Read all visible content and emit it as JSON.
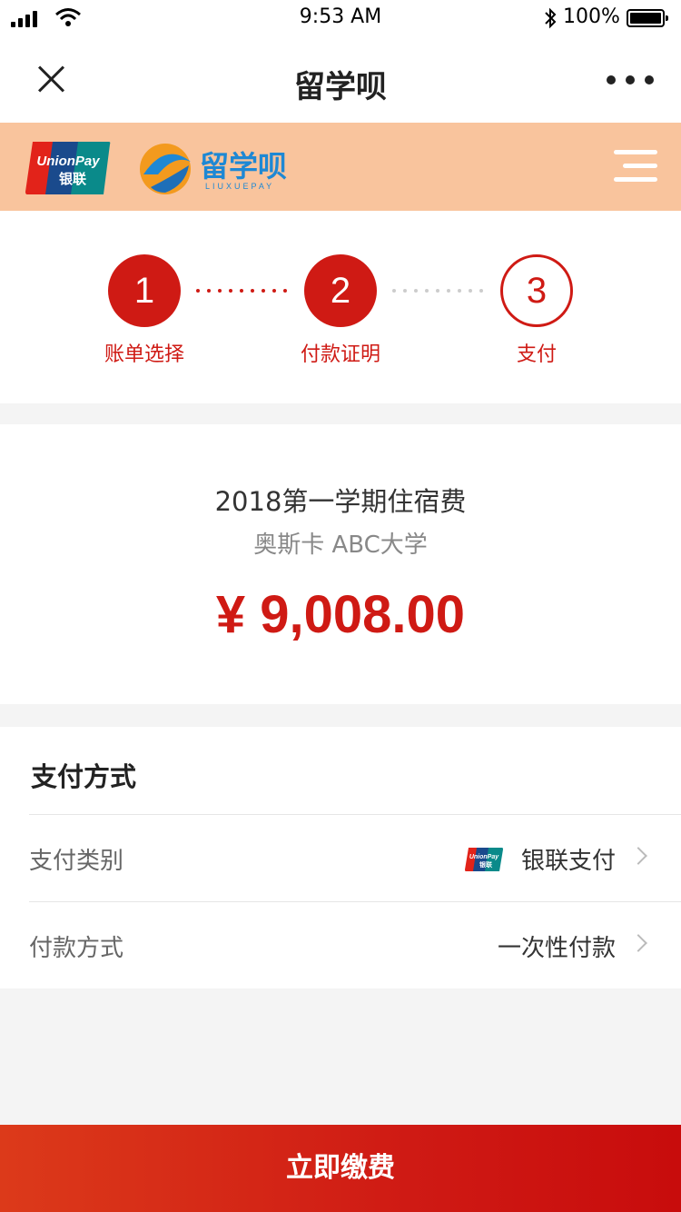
{
  "status_bar": {
    "time": "9:53 AM",
    "battery": "100%",
    "icons": [
      "signal-icon",
      "wifi-icon",
      "bluetooth-icon",
      "battery-icon"
    ]
  },
  "nav": {
    "title": "留学呗",
    "left_icon": "close-icon",
    "right_icon": "more-icon"
  },
  "banner": {
    "unionpay_text_top": "UnionPay",
    "unionpay_text_bottom": "银联",
    "brand_name": "留学呗",
    "brand_sub": "LIUXUEPAY",
    "menu_icon": "menu-icon"
  },
  "steps": [
    {
      "number": "1",
      "label": "账单选择",
      "state": "done"
    },
    {
      "number": "2",
      "label": "付款证明",
      "state": "done"
    },
    {
      "number": "3",
      "label": "支付",
      "state": "current"
    }
  ],
  "bill": {
    "title": "2018第一学期住宿费",
    "school": "奥斯卡 ABC大学",
    "amount": "¥ 9,008.00"
  },
  "payment": {
    "header": "支付方式",
    "rows": [
      {
        "label": "支付类别",
        "value": "银联支付",
        "icon": "unionpay-icon"
      },
      {
        "label": "付款方式",
        "value": "一次性付款"
      }
    ]
  },
  "footer": {
    "pay_label": "立即缴费"
  },
  "colors": {
    "accent": "#cf1a14",
    "banner_bg": "#f9c49d"
  }
}
